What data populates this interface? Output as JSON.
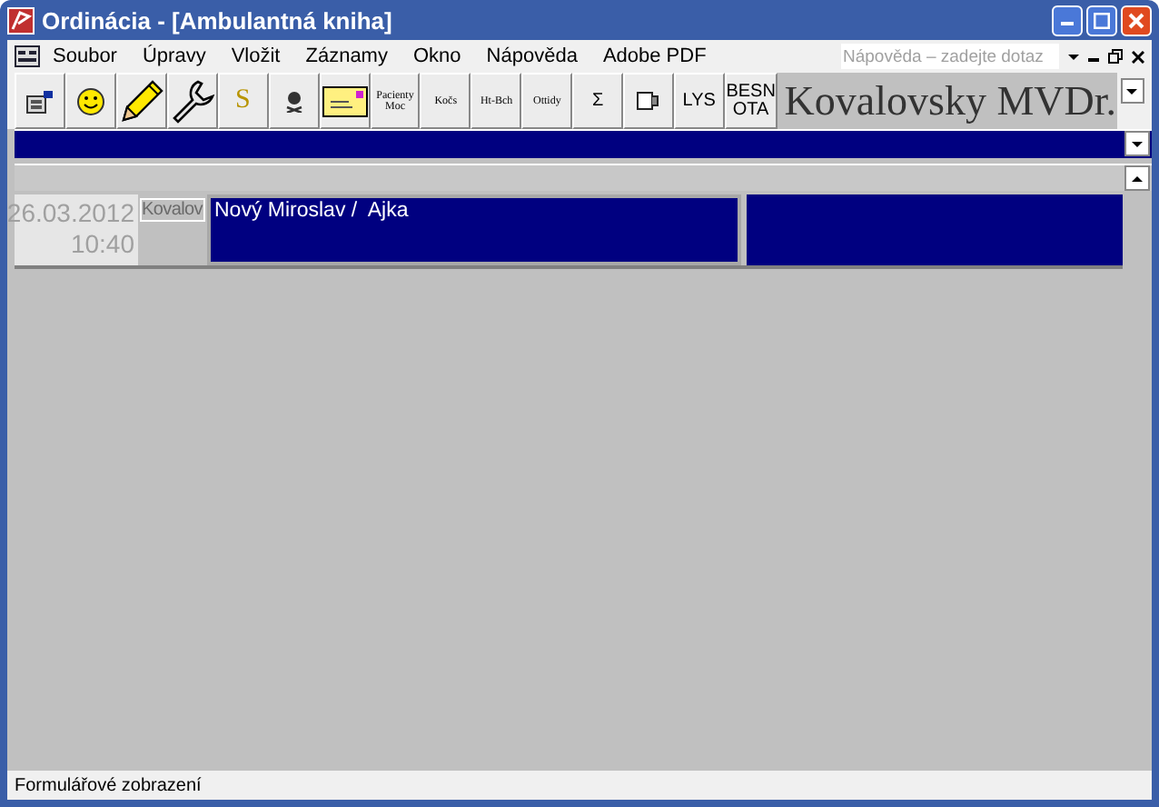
{
  "window": {
    "title": "Ordinácia - [Ambulantná kniha]"
  },
  "menu": [
    "Soubor",
    "Úpravy",
    "Vložit",
    "Záznamy",
    "Okno",
    "Nápověda",
    "Adobe PDF"
  ],
  "help_search": {
    "placeholder": "Nápověda – zadejte dotaz"
  },
  "toolbar": [
    {
      "kind": "icon"
    },
    {
      "kind": "icon"
    },
    {
      "kind": "icon"
    },
    {
      "kind": "icon"
    },
    {
      "kind": "glyph",
      "label": "S"
    },
    {
      "kind": "icon"
    },
    {
      "kind": "icon"
    },
    {
      "kind": "tiny",
      "label": "Pacienty Moc"
    },
    {
      "kind": "tiny",
      "label": "Kočs"
    },
    {
      "kind": "tiny",
      "label": "Ht-Bch"
    },
    {
      "kind": "tiny",
      "label": "Ottidy"
    },
    {
      "kind": "text",
      "label": "Σ"
    },
    {
      "kind": "icon"
    },
    {
      "kind": "text",
      "label": "LYS"
    },
    {
      "kind": "text",
      "label": "BESN OTA"
    }
  ],
  "doctor": "Kovalovsky MVDr.",
  "record": {
    "date": "26.03.2012",
    "time": "10:40",
    "doctor_short": "Kovalov",
    "patient": "Nový Miroslav /  Ajka"
  },
  "status_bar": "Formulářové zobrazení"
}
